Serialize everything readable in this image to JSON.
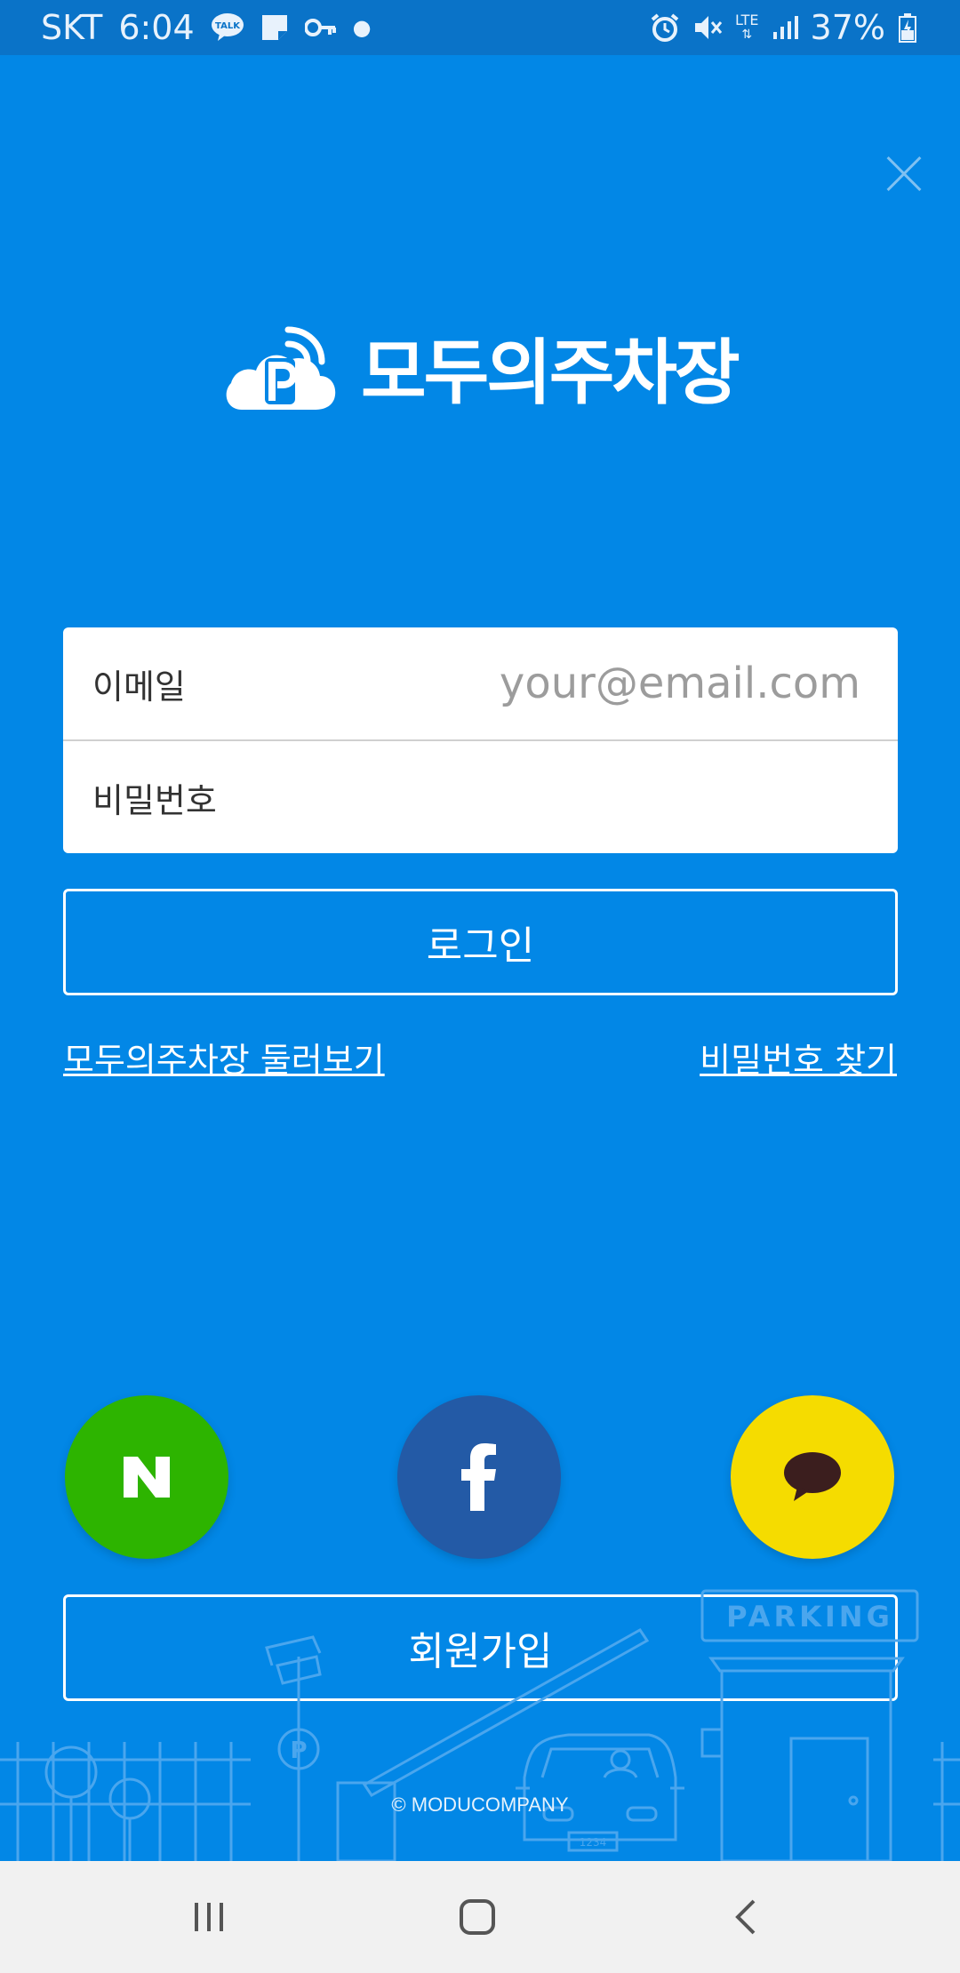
{
  "status_bar": {
    "carrier": "SKT",
    "time": "6:04",
    "battery": "37%",
    "network": "LTE",
    "icons_left": [
      "kakaotalk-talk-icon",
      "sticky-note-icon",
      "key-icon",
      "dot-icon"
    ],
    "icons_right": [
      "alarm-icon",
      "mute-icon",
      "lte-icon",
      "signal-icon",
      "battery-icon"
    ],
    "talk_badge": "TALK"
  },
  "app": {
    "name": "모두의주차장",
    "accent": "#0287e6"
  },
  "login_form": {
    "email_label": "이메일",
    "email_placeholder": "your@email.com",
    "password_label": "비밀번호",
    "password_placeholder": ""
  },
  "buttons": {
    "login": "로그인",
    "signup": "회원가입"
  },
  "links": {
    "browse": "모두의주차장 둘러보기",
    "find_password": "비밀번호 찾기"
  },
  "social": {
    "naver": {
      "label": "N",
      "color": "#2db400"
    },
    "facebook": {
      "label": "f",
      "color": "#235aa6"
    },
    "kakao": {
      "color": "#f5dc00"
    }
  },
  "illustration": {
    "parking_sign": "PARKING",
    "plate": "1234",
    "pole_sign": "P"
  },
  "footer": {
    "copyright": "© MODUCOMPANY"
  }
}
